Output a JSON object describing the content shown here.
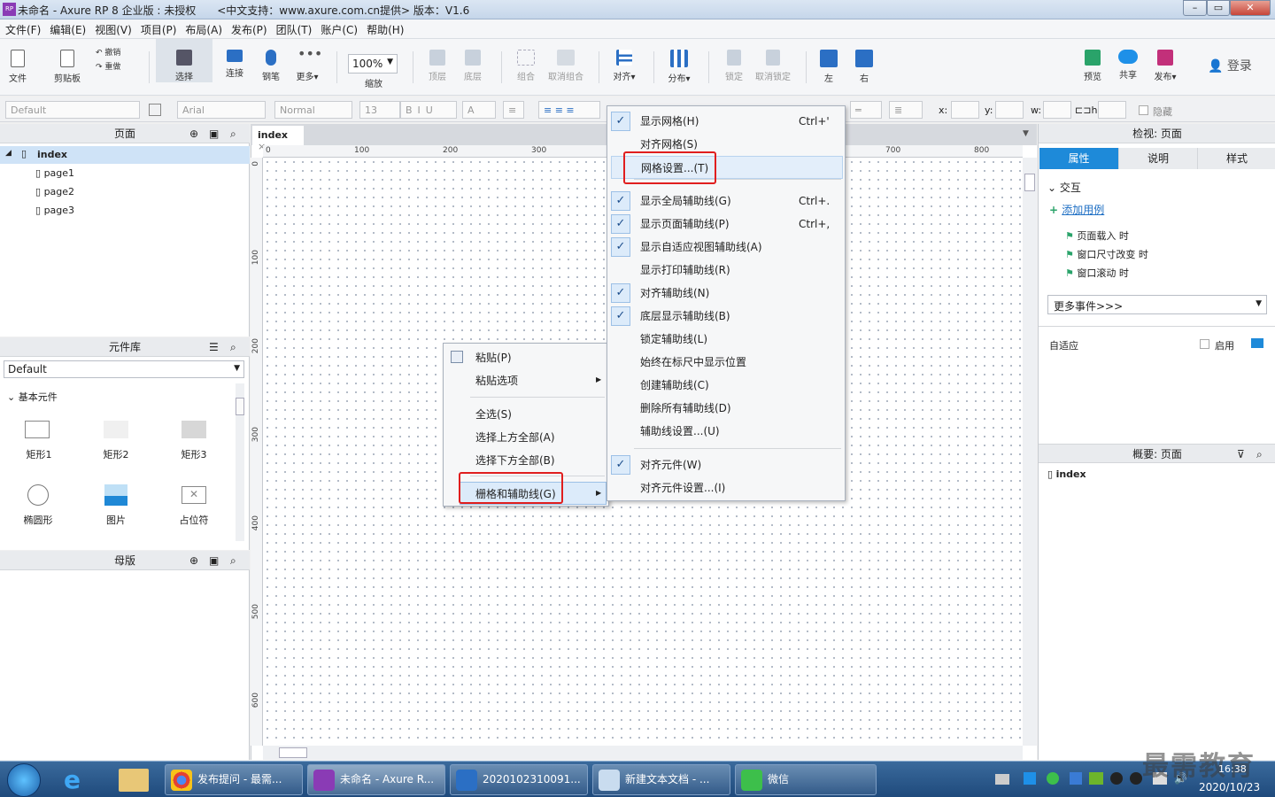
{
  "window": {
    "title": "未命名 - Axure RP 8 企业版 : 未授权　　<中文支持：www.axure.com.cn提供> 版本：V1.6",
    "app_icon": "RP",
    "controls": [
      "minimize-icon",
      "maximize-icon",
      "close-icon"
    ]
  },
  "menubar": [
    "文件(F)",
    "编辑(E)",
    "视图(V)",
    "项目(P)",
    "布局(A)",
    "发布(P)",
    "团队(T)",
    "账户(C)",
    "帮助(H)"
  ],
  "toolbar": {
    "file": "文件",
    "clipboard": "剪贴板",
    "undo": "撤销",
    "redo": "重做",
    "select": "选择",
    "connect": "连接",
    "pen": "钢笔",
    "more": "更多▾",
    "zoom_value": "100%",
    "zoom": "缩放",
    "top": "顶层",
    "bottom": "底层",
    "group": "组合",
    "ungroup": "取消组合",
    "align": "对齐▾",
    "distribute": "分布▾",
    "lock": "锁定",
    "unlock": "取消锁定",
    "left": "左",
    "right": "右",
    "preview": "预览",
    "share": "共享",
    "publish": "发布▾",
    "login": "登录"
  },
  "format_bar": {
    "style": "Default",
    "font": "Arial",
    "weight": "Normal",
    "size": "13",
    "x_label": "x:",
    "y_label": "y:",
    "w_label": "w:",
    "h_label": "h:",
    "hidden": "隐藏"
  },
  "pages_panel": {
    "title": "页面",
    "items": [
      "index",
      "page1",
      "page2",
      "page3"
    ]
  },
  "library_panel": {
    "title": "元件库",
    "selected": "Default",
    "section": "基本元件",
    "widgets": [
      "矩形1",
      "矩形2",
      "矩形3",
      "椭圆形",
      "图片",
      "占位符"
    ]
  },
  "masters_panel": {
    "title": "母版"
  },
  "canvas": {
    "tab": "index",
    "ruler_x": [
      "0",
      "100",
      "200",
      "300",
      "700",
      "800"
    ],
    "ruler_y": [
      "0",
      "100",
      "200",
      "300",
      "400",
      "500",
      "600"
    ]
  },
  "context_menu": {
    "items": [
      "粘贴(P)",
      "粘贴选项",
      "全选(S)",
      "选择上方全部(A)",
      "选择下方全部(B)",
      "栅格和辅助线(G)"
    ]
  },
  "submenu": {
    "items": [
      {
        "label": "显示网格(H)",
        "shortcut": "Ctrl+'",
        "checked": true
      },
      {
        "label": "对齐网格(S)",
        "shortcut": "",
        "checked": false
      },
      {
        "label": "网格设置...(T)",
        "shortcut": "",
        "checked": false
      },
      {
        "label": "显示全局辅助线(G)",
        "shortcut": "Ctrl+.",
        "checked": true
      },
      {
        "label": "显示页面辅助线(P)",
        "shortcut": "Ctrl+,",
        "checked": true
      },
      {
        "label": "显示自适应视图辅助线(A)",
        "shortcut": "",
        "checked": true
      },
      {
        "label": "显示打印辅助线(R)",
        "shortcut": "",
        "checked": false
      },
      {
        "label": "对齐辅助线(N)",
        "shortcut": "",
        "checked": true
      },
      {
        "label": "底层显示辅助线(B)",
        "shortcut": "",
        "checked": true
      },
      {
        "label": "锁定辅助线(L)",
        "shortcut": "",
        "checked": false
      },
      {
        "label": "始终在标尺中显示位置",
        "shortcut": "",
        "checked": false
      },
      {
        "label": "创建辅助线(C)",
        "shortcut": "",
        "checked": false
      },
      {
        "label": "删除所有辅助线(D)",
        "shortcut": "",
        "checked": false
      },
      {
        "label": "辅助线设置...(U)",
        "shortcut": "",
        "checked": false
      },
      {
        "label": "对齐元件(W)",
        "shortcut": "",
        "checked": true
      },
      {
        "label": "对齐元件设置...(I)",
        "shortcut": "",
        "checked": false
      }
    ]
  },
  "inspector": {
    "title": "检视: 页面",
    "tabs": [
      "属性",
      "说明",
      "样式"
    ],
    "interaction": "交互",
    "add_case": "添加用例",
    "events": [
      "页面载入 时",
      "窗口尺寸改变 时",
      "窗口滚动 时"
    ],
    "more_events": "更多事件>>>",
    "adaptive": "自适应",
    "enable": "启用"
  },
  "outline": {
    "title": "概要: 页面",
    "item": "index"
  },
  "taskbar": {
    "tasks": [
      "发布提问 - 最需...",
      "未命名 - Axure R...",
      "2020102310091...",
      "新建文本文档 - ...",
      "微信"
    ],
    "time": "16:38",
    "date": "2020/10/23",
    "watermark": "最需教育"
  }
}
